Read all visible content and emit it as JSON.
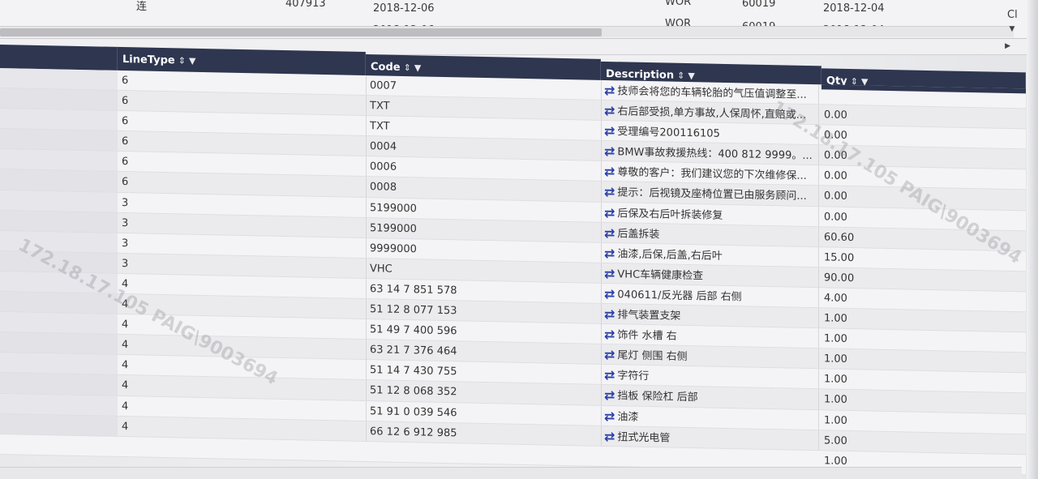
{
  "top_grid": {
    "rows": [
      {
        "c0": "连",
        "c1": "407913",
        "c2": "2018-12-06",
        "c3": "WOR",
        "c4": "60019",
        "c5": "2018-12-04",
        "c6": "Cl"
      },
      {
        "c0": "",
        "c1": "",
        "c2": "2018-12-06",
        "c3": "WOR",
        "c4": "60019",
        "c5": "2018-12-04",
        "c6": ""
      }
    ],
    "scroll_arrow_down": "▼",
    "scroll_arrow_right": "▶"
  },
  "columns": {
    "linetype": "LineType",
    "code": "Code",
    "description": "Description",
    "qty": "Qty",
    "sort_icon": "⇕",
    "filter_icon": "▼"
  },
  "rows": [
    {
      "linetype": "6",
      "code": "0007",
      "description": "技师会将您的车辆轮胎的气压值调整至...",
      "qty": ""
    },
    {
      "linetype": "6",
      "code": "TXT",
      "description": "右后部受损,单方事故,人保周怀,直赔或...",
      "qty": "0.00"
    },
    {
      "linetype": "6",
      "code": "TXT",
      "description": "受理编号200116105",
      "qty": "0.00"
    },
    {
      "linetype": "6",
      "code": "0004",
      "description": "BMW事故救援热线：400 812 9999。...",
      "qty": "0.00"
    },
    {
      "linetype": "6",
      "code": "0006",
      "description": "尊敬的客户：我们建议您的下次维修保...",
      "qty": "0.00"
    },
    {
      "linetype": "6",
      "code": "0008",
      "description": "提示：后视镜及座椅位置已由服务顾问...",
      "qty": "0.00"
    },
    {
      "linetype": "3",
      "code": "5199000",
      "description": "后保及右后叶拆装修复",
      "qty": "0.00"
    },
    {
      "linetype": "3",
      "code": "5199000",
      "description": "后盖拆装",
      "qty": "60.60"
    },
    {
      "linetype": "3",
      "code": "9999000",
      "description": "油漆,后保,后盖,右后叶",
      "qty": "15.00"
    },
    {
      "linetype": "3",
      "code": "VHC",
      "description": "VHC车辆健康检查",
      "qty": "90.00"
    },
    {
      "linetype": "4",
      "code": "63 14 7 851 578",
      "description": "040611/反光器 后部 右侧",
      "qty": "4.00"
    },
    {
      "linetype": "4",
      "code": "51 12 8 077 153",
      "description": "排气装置支架",
      "qty": "1.00"
    },
    {
      "linetype": "4",
      "code": "51 49 7 400 596",
      "description": "饰件 水槽 右",
      "qty": "1.00"
    },
    {
      "linetype": "4",
      "code": "63 21 7 376 464",
      "description": "尾灯 侧围 右侧",
      "qty": "1.00"
    },
    {
      "linetype": "4",
      "code": "51 14 7 430 755",
      "description": "字符行",
      "qty": "1.00"
    },
    {
      "linetype": "4",
      "code": "51 12 8 068 352",
      "description": "挡板 保险杠 后部",
      "qty": "1.00"
    },
    {
      "linetype": "4",
      "code": "51 91 0 039 546",
      "description": "油漆",
      "qty": "1.00"
    },
    {
      "linetype": "4",
      "code": "66 12 6 912 985",
      "description": "扭式光电管",
      "qty": "5.00"
    }
  ],
  "trailing_qty": "1.00",
  "watermark": "172.18.17.105  PAIG\\9003694",
  "colors": {
    "header_bg": "#2e3650",
    "swap_icon": "#2a3fa8"
  }
}
